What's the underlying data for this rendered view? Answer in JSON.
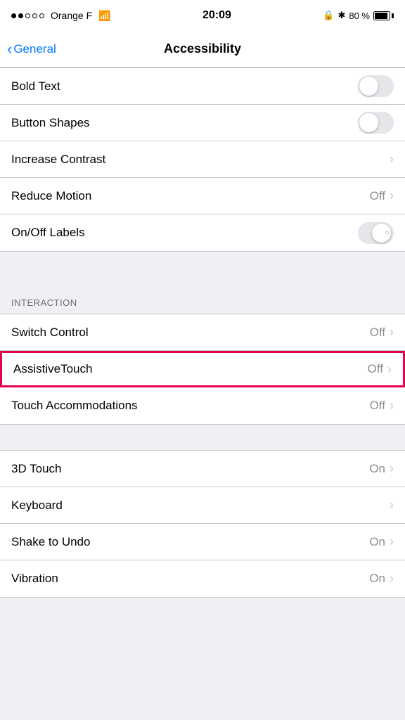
{
  "statusBar": {
    "dots": [
      "filled",
      "filled",
      "empty",
      "empty",
      "empty"
    ],
    "carrier": "Orange F",
    "time": "20:09",
    "bluetooth": "✴",
    "battery_pct": "80 %"
  },
  "nav": {
    "back_label": "General",
    "title": "Accessibility"
  },
  "sections": [
    {
      "header": null,
      "rows": [
        {
          "label": "Bold Text",
          "type": "toggle",
          "toggle_state": "off",
          "value": null
        },
        {
          "label": "Button Shapes",
          "type": "toggle",
          "toggle_state": "off",
          "value": null
        },
        {
          "label": "Increase Contrast",
          "type": "chevron",
          "value": null
        },
        {
          "label": "Reduce Motion",
          "type": "chevron",
          "value": "Off"
        },
        {
          "label": "On/Off Labels",
          "type": "toggle-partial",
          "toggle_state": "partial",
          "value": null
        }
      ]
    },
    {
      "header": "INTERACTION",
      "rows": [
        {
          "label": "Switch Control",
          "type": "chevron",
          "value": "Off"
        },
        {
          "label": "AssistiveTouch",
          "type": "chevron",
          "value": "Off",
          "highlighted": true
        },
        {
          "label": "Touch Accommodations",
          "type": "chevron",
          "value": "Off"
        }
      ]
    },
    {
      "header": null,
      "rows": [
        {
          "label": "3D Touch",
          "type": "chevron",
          "value": "On"
        },
        {
          "label": "Keyboard",
          "type": "chevron",
          "value": null
        },
        {
          "label": "Shake to Undo",
          "type": "chevron",
          "value": "On"
        },
        {
          "label": "Vibration",
          "type": "chevron",
          "value": "On"
        }
      ]
    }
  ]
}
